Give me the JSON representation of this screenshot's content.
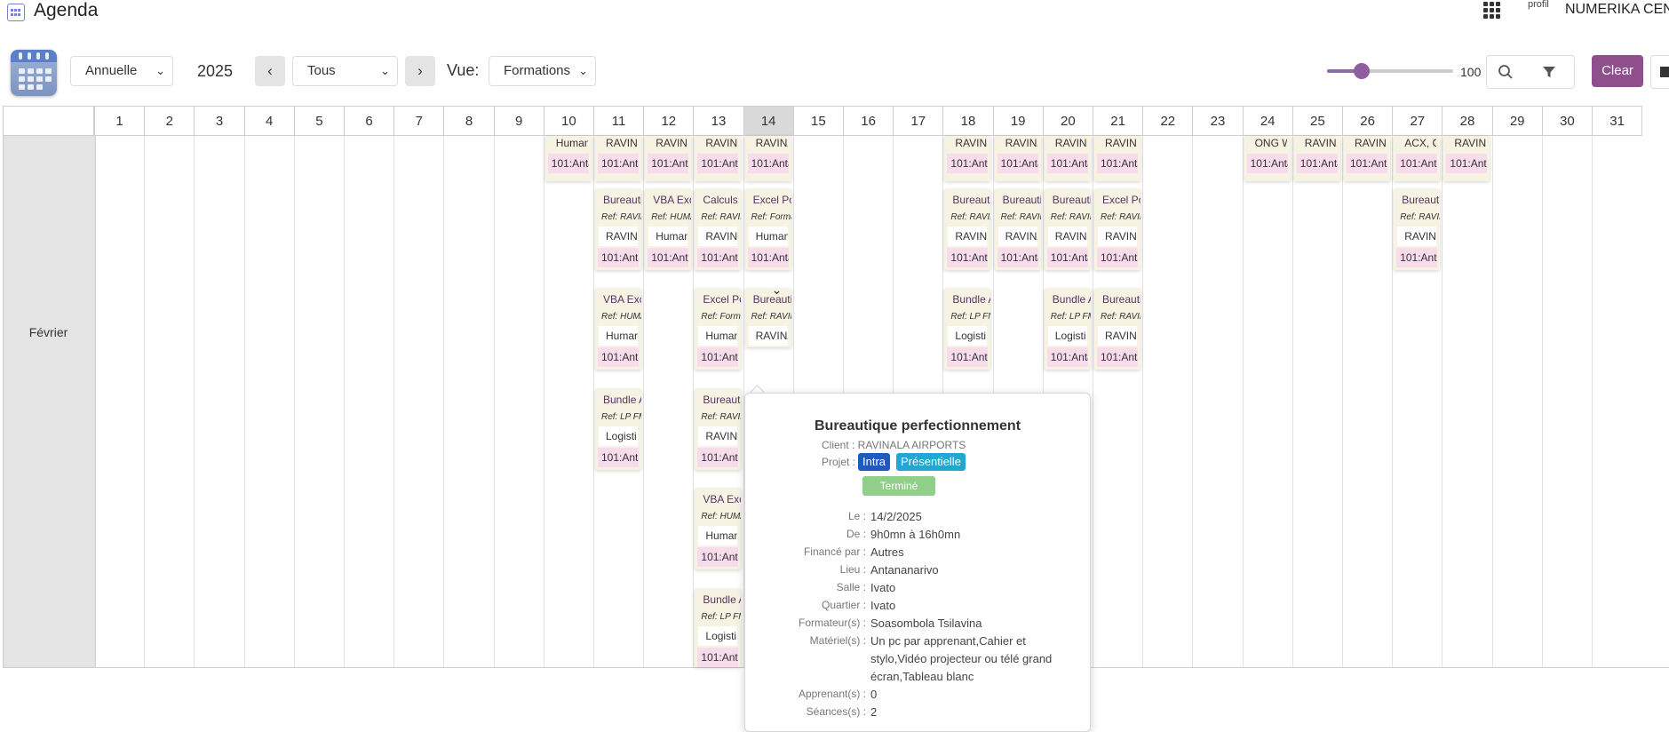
{
  "app": {
    "title": "Agenda",
    "profile_alt": "profil",
    "company": "NUMERIKA CENTER"
  },
  "toolbar": {
    "period_select": "Annuelle",
    "year": "2025",
    "prev": "‹",
    "next": "›",
    "filter_select": "Tous",
    "vue_label": "Vue:",
    "vue_select": "Formations",
    "zoom_value": "100",
    "zoom_level": 0.2,
    "clear_label": "Clear"
  },
  "calendar": {
    "days": [
      "1",
      "2",
      "3",
      "4",
      "5",
      "6",
      "7",
      "8",
      "9",
      "10",
      "11",
      "12",
      "13",
      "14",
      "15",
      "16",
      "17",
      "18",
      "19",
      "20",
      "21",
      "22",
      "23",
      "24",
      "25",
      "26",
      "27",
      "28",
      "29",
      "30",
      "31"
    ],
    "highlight_day": "14",
    "month": "Février"
  },
  "events": {
    "row1": [
      {
        "title": "Human",
        "loc": "101:Anta"
      },
      {
        "title": "RAVINA",
        "loc": "101:Anta"
      },
      {
        "title": "RAVINA",
        "loc": "101:Anta"
      },
      {
        "title": "RAVINA",
        "loc": "101:Anta"
      },
      {
        "title": "RAVINA",
        "loc": "101:Anta"
      },
      {
        "title": "RAVINA",
        "loc": "101:Anta"
      },
      {
        "title": "RAVINA",
        "loc": "101:Anta"
      },
      {
        "title": "RAVINA",
        "loc": "101:Anta"
      },
      {
        "title": "RAVINA",
        "loc": "101:Anta"
      },
      {
        "title": "ONG W",
        "loc": "101:Anta"
      },
      {
        "title": "RAVINA",
        "loc": "101:Anta"
      },
      {
        "title": "RAVINA",
        "loc": "101:Anta"
      },
      {
        "title": "ACX, C",
        "loc": "101:Anta"
      },
      {
        "title": "RAVINA",
        "loc": "101:Anta"
      }
    ],
    "cards": [
      {
        "title": "Bureauti",
        "ref": "Ref: RAVIN",
        "client": "RAVINA",
        "loc": "101:Anta"
      },
      {
        "title": "VBA Exc",
        "ref": "Ref: HUMA",
        "client": "Human",
        "loc": "101:Anta"
      },
      {
        "title": "Calculs e",
        "ref": "Ref: RAVIN",
        "client": "RAVINA",
        "loc": "101:Anta"
      },
      {
        "title": "Excel Po",
        "ref": "Ref: Forma",
        "client": "Human",
        "loc": "101:Anta"
      },
      {
        "title": "Bureauti",
        "ref": "Ref: RAVIN",
        "client": "RAVINA",
        "loc": "101:Anta"
      },
      {
        "title": "Bureauti",
        "ref": "Ref: RAVIN",
        "client": "RAVINA",
        "loc": "101:Anta"
      },
      {
        "title": "Bureauti",
        "ref": "Ref: RAVIN",
        "client": "RAVINA",
        "loc": "101:Anta"
      },
      {
        "title": "Excel Po",
        "ref": "Ref: RAVIN",
        "client": "RAVINA",
        "loc": "101:Anta"
      },
      {
        "title": "Bureauti",
        "ref": "Ref: RAVIN",
        "client": "RAVINA",
        "loc": "101:Anta"
      },
      {
        "title": "VBA Exc",
        "ref": "Ref: HUMA",
        "client": "Human",
        "loc": "101:Anta"
      },
      {
        "title": "Excel Po",
        "ref": "Ref: Forma",
        "client": "Human",
        "loc": "101:Anta"
      },
      {
        "title": "Bureauti",
        "ref": "Ref: RAVIN",
        "client": "RAVINA",
        "loc": ""
      },
      {
        "title": "Bundle A",
        "ref": "Ref: LP FM",
        "client": "Logisti",
        "loc": "101:Anta"
      },
      {
        "title": "Bundle A",
        "ref": "Ref: LP FM",
        "client": "Logisti",
        "loc": "101:Anta"
      },
      {
        "title": "Bureauti",
        "ref": "Ref: RAVIN",
        "client": "RAVINA",
        "loc": "101:Anta"
      },
      {
        "title": "Bundle A",
        "ref": "Ref: LP FM",
        "client": "Logisti",
        "loc": "101:Anta"
      },
      {
        "title": "Bureauti",
        "ref": "Ref: RAVIN",
        "client": "RAVINA",
        "loc": "101:Anta"
      },
      {
        "title": "VBA Exc",
        "ref": "Ref: HUMA",
        "client": "Human",
        "loc": "101:Anta"
      },
      {
        "title": "Bundle A",
        "ref": "Ref: LP FM",
        "client": "Logisti",
        "loc": "101:Anta"
      }
    ]
  },
  "popup": {
    "title": "Bureautique perfectionnement",
    "client": "Client : RAVINALA AIRPORTS",
    "projet_label": "Projet :",
    "tag_intra": "Intra",
    "tag_presentielle": "Présentielle",
    "status": "Terminé",
    "rows": [
      {
        "label": "Le :",
        "value": "14/2/2025"
      },
      {
        "label": "De :",
        "value": "9h0mn à 16h0mn"
      },
      {
        "label": "Financé par :",
        "value": "Autres"
      },
      {
        "label": "Lieu :",
        "value": "Antananarivo"
      },
      {
        "label": "Salle :",
        "value": "Ivato"
      },
      {
        "label": "Quartier :",
        "value": "Ivato"
      },
      {
        "label": "Formateur(s) :",
        "value": "Soasombola Tsilavina"
      },
      {
        "label": "Matériel(s) :",
        "value": "Un pc par apprenant,Cahier et stylo,Vidéo projecteur ou télé grand écran,Tableau blanc"
      },
      {
        "label": "Apprenant(s) :",
        "value": "0"
      },
      {
        "label": "Séances(s) :",
        "value": "2"
      }
    ]
  },
  "colors": {
    "accent": "#8e4f8c",
    "intra": "#1f5bbf",
    "presentielle": "#22a7d2",
    "termine": "#8fcf8a",
    "card_bg": "#f6f3e3",
    "card_loc": "#f8dcec"
  }
}
